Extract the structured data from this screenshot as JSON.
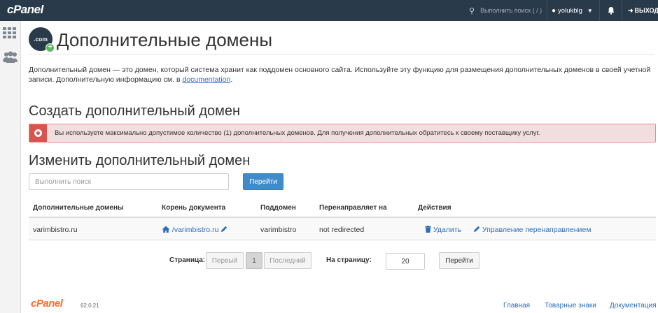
{
  "header": {
    "logo": "cPanel",
    "search_placeholder": "Выполнить поиск ( / )",
    "username": "yolukblg",
    "logout": "ВЫХОД"
  },
  "page": {
    "icon_label": ".com",
    "title": "Дополнительные домены",
    "description": "Дополнительный домен — это домен, который система хранит как поддомен основного сайта. Используйте эту функцию для размещения дополнительных доменов в своей учетной записи. Дополнительную информацию см. в ",
    "doc_link": "documentation",
    "desc_end": "."
  },
  "create": {
    "heading": "Создать дополнительный домен",
    "alert": "Вы используете максимально допустимое количество (1) дополнительных доменов. Для получения дополнительных обратитесь к своему поставщику услуг."
  },
  "modify": {
    "heading": "Изменить дополнительный домен",
    "search_placeholder": "Выполнить поиск",
    "go_button": "Перейти"
  },
  "table": {
    "headers": [
      "Дополнительные домены",
      "Корень документа",
      "Поддомен",
      "Перенаправляет на",
      "Действия"
    ],
    "rows": [
      {
        "domain": "varimbistro.ru",
        "docroot": "/varimbistro.ru",
        "subdomain": "varimbistro",
        "redirect": "not redirected",
        "delete": "Удалить",
        "manage_redirect": "Управление перенаправлением"
      }
    ]
  },
  "pagination": {
    "page_label": "Страница:",
    "first": "Первый",
    "current": "1",
    "last": "Последний",
    "per_page_label": "На страницу:",
    "per_page_value": "20",
    "go_button": "Перейти"
  },
  "footer": {
    "logo": "cPanel",
    "version": "62.0.21",
    "links": [
      "Главная",
      "Товарные знаки",
      "Документация"
    ]
  }
}
